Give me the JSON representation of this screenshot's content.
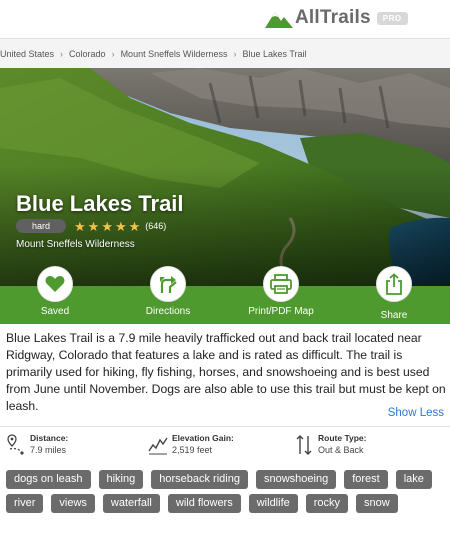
{
  "header": {
    "brand": "AllTrails",
    "badge": "PRO",
    "logo_color": "#4e9a2e"
  },
  "breadcrumb": [
    "United States",
    "Colorado",
    "Mount Sneffels Wilderness",
    "Blue Lakes Trail"
  ],
  "breadcrumb_separator": "›",
  "hero": {
    "title": "Blue Lakes Trail",
    "difficulty": "hard",
    "rating": 5,
    "star_glyph": "★",
    "review_count": "(646)",
    "area": "Mount Sneffels Wilderness"
  },
  "actions": [
    {
      "label": "Saved",
      "icon": "heart-icon"
    },
    {
      "label": "Directions",
      "icon": "directions-icon"
    },
    {
      "label": "Print/PDF Map",
      "icon": "printer-icon"
    },
    {
      "label": "Share",
      "icon": "share-icon"
    }
  ],
  "description": "Blue Lakes Trail is a 7.9 mile heavily trafficked out and back trail located near Ridgway, Colorado that features a lake and is rated as difficult. The trail is primarily used for hiking, fly fishing, horses, and snowshoeing and is best used from June until November. Dogs are also able to use this trail but must be kept on leash.",
  "show_less": "Show Less",
  "stats": {
    "distance": {
      "label": "Distance:",
      "value": "7.9 miles",
      "icon": "distance-pin-icon"
    },
    "elevation": {
      "label": "Elevation Gain:",
      "value": "2,519 feet",
      "icon": "elevation-icon"
    },
    "route": {
      "label": "Route Type:",
      "value": "Out & Back",
      "icon": "route-arrows-icon"
    }
  },
  "tags": [
    "dogs on leash",
    "hiking",
    "horseback riding",
    "snowshoeing",
    "forest",
    "lake",
    "river",
    "views",
    "waterfall",
    "wild flowers",
    "wildlife",
    "rocky",
    "snow"
  ],
  "colors": {
    "accent_green": "#4e9a2e",
    "link_blue": "#2a7bd4",
    "tag_gray": "#6b6b6b",
    "star_gold": "#f6c244"
  }
}
